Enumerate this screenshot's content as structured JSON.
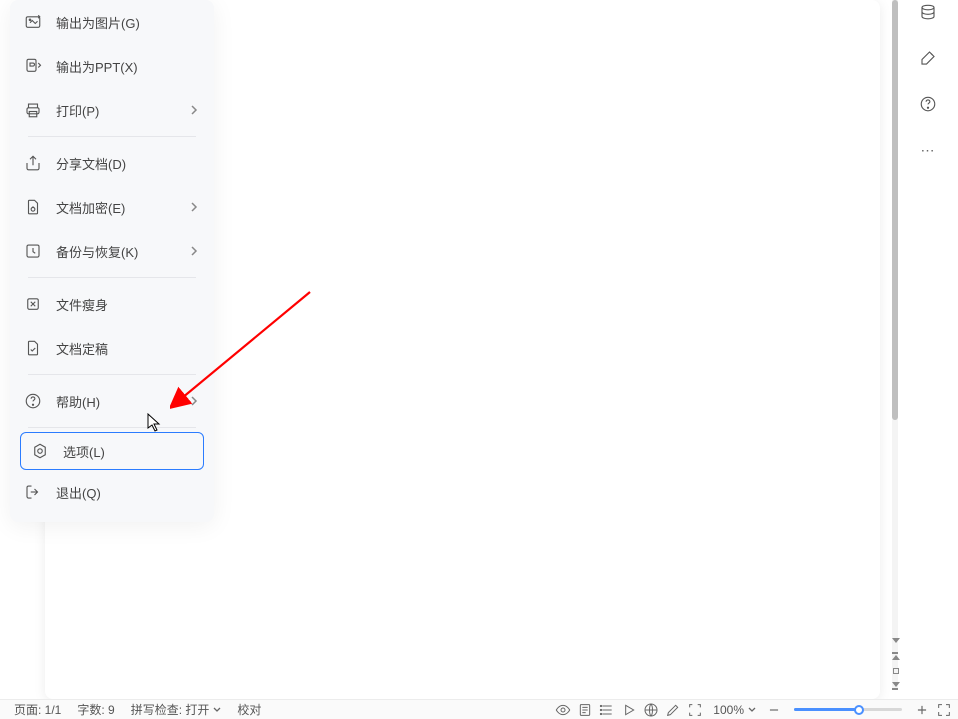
{
  "menu": {
    "items": [
      {
        "label": "输出为图片(G)",
        "icon": "export-image-icon",
        "has_sub": false
      },
      {
        "label": "输出为PPT(X)",
        "icon": "export-ppt-icon",
        "has_sub": false
      },
      {
        "label": "打印(P)",
        "icon": "print-icon",
        "has_sub": true
      },
      {
        "sep": true
      },
      {
        "label": "分享文档(D)",
        "icon": "share-icon",
        "has_sub": false
      },
      {
        "label": "文档加密(E)",
        "icon": "encrypt-icon",
        "has_sub": true
      },
      {
        "label": "备份与恢复(K)",
        "icon": "backup-icon",
        "has_sub": true
      },
      {
        "sep": true
      },
      {
        "label": "文件瘦身",
        "icon": "compress-icon",
        "has_sub": false
      },
      {
        "label": "文档定稿",
        "icon": "finalize-icon",
        "has_sub": false
      },
      {
        "sep": true
      },
      {
        "label": "帮助(H)",
        "icon": "help-icon",
        "has_sub": true
      },
      {
        "sep": true
      },
      {
        "label": "选项(L)",
        "icon": "settings-icon",
        "has_sub": false,
        "highlight": true
      },
      {
        "label": "退出(Q)",
        "icon": "exit-icon",
        "has_sub": false
      }
    ]
  },
  "statusbar": {
    "page": "页面: 1/1",
    "words": "字数: 9",
    "spellcheck": "拼写检查: 打开",
    "proof": "校对",
    "zoom_label": "100%"
  },
  "right_toolbar": {
    "more": "⋯"
  }
}
